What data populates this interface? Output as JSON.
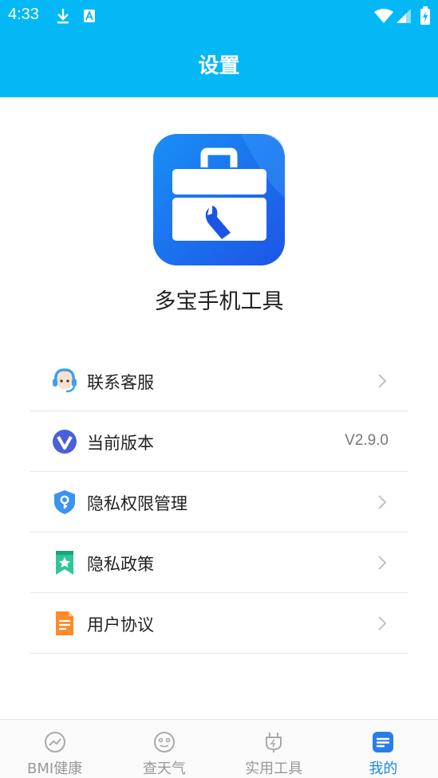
{
  "status_bar": {
    "time": "4:33"
  },
  "header": {
    "title": "设置"
  },
  "app": {
    "name": "多宝手机工具"
  },
  "menu": [
    {
      "label": "联系客服",
      "icon": "customer-service-icon",
      "chevron": true
    },
    {
      "label": "当前版本",
      "icon": "version-icon",
      "value": "V2.9.0"
    },
    {
      "label": "隐私权限管理",
      "icon": "shield-key-icon",
      "chevron": true
    },
    {
      "label": "隐私政策",
      "icon": "bookmark-star-icon",
      "chevron": true
    },
    {
      "label": "用户协议",
      "icon": "document-icon",
      "chevron": true
    }
  ],
  "tabs": [
    {
      "label": "BMI健康",
      "icon": "trend-icon",
      "active": false
    },
    {
      "label": "查天气",
      "icon": "weather-face-icon",
      "active": false
    },
    {
      "label": "实用工具",
      "icon": "plug-icon",
      "active": false
    },
    {
      "label": "我的",
      "icon": "profile-icon",
      "active": true
    }
  ],
  "colors": {
    "primary": "#03b8f5",
    "tab_active": "#1e88e5",
    "tab_inactive": "#999999"
  }
}
